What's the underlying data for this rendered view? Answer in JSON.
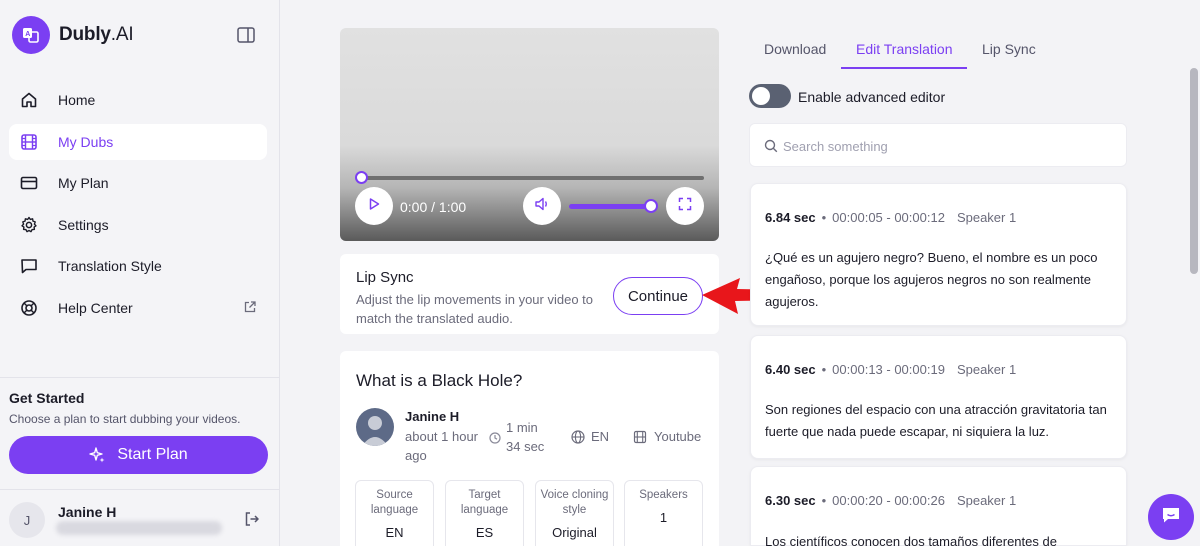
{
  "brand": {
    "name": "Dubly",
    "suffix": ".AI",
    "accent": "#7b3ff2"
  },
  "sidebar": {
    "items": [
      {
        "label": "Home",
        "icon": "home-icon"
      },
      {
        "label": "My Dubs",
        "icon": "film-icon",
        "active": true
      },
      {
        "label": "My Plan",
        "icon": "credit-card-icon"
      },
      {
        "label": "Settings",
        "icon": "gear-icon"
      },
      {
        "label": "Translation Style",
        "icon": "chat-bubble-icon"
      },
      {
        "label": "Help Center",
        "icon": "lifebuoy-icon",
        "external": true
      }
    ],
    "get_started": {
      "title": "Get Started",
      "subtitle": "Choose a plan to start dubbing your videos.",
      "button": "Start Plan"
    },
    "user": {
      "initial": "J",
      "name": "Janine H"
    }
  },
  "player": {
    "time": "0:00 / 1:00",
    "progress": 0,
    "volume": 1.0
  },
  "lip_sync": {
    "title": "Lip Sync",
    "description": "Adjust the lip movements in your video to match the translated audio.",
    "button": "Continue"
  },
  "video_info": {
    "title": "What is a Black Hole?",
    "author": "Janine H",
    "posted": "about 1 hour ago",
    "duration": "1 min 34 sec",
    "language": "EN",
    "source": "Youtube",
    "stats": [
      {
        "label": "Source language",
        "value": "EN"
      },
      {
        "label": "Target language",
        "value": "ES"
      },
      {
        "label": "Voice cloning style",
        "value": "Original"
      },
      {
        "label": "Speakers",
        "value": "1"
      }
    ]
  },
  "tabs": [
    {
      "label": "Download"
    },
    {
      "label": "Edit Translation",
      "active": true
    },
    {
      "label": "Lip Sync"
    }
  ],
  "editor": {
    "toggle_label": "Enable advanced editor",
    "toggle_on": false,
    "search_placeholder": "Search something"
  },
  "segments": [
    {
      "duration": "6.84 sec",
      "range": "00:00:05 - 00:00:12",
      "speaker": "Speaker 1",
      "text": "¿Qué es un agujero negro? Bueno, el nombre es un poco engañoso, porque los agujeros negros no son realmente agujeros."
    },
    {
      "duration": "6.40 sec",
      "range": "00:00:13 - 00:00:19",
      "speaker": "Speaker 1",
      "text": "Son regiones del espacio con una atracción gravitatoria tan fuerte que nada puede escapar, ni siquiera la luz."
    },
    {
      "duration": "6.30 sec",
      "range": "00:00:20 - 00:00:26",
      "speaker": "Speaker 1",
      "text": "Los científicos conocen dos tamaños diferentes de"
    }
  ]
}
